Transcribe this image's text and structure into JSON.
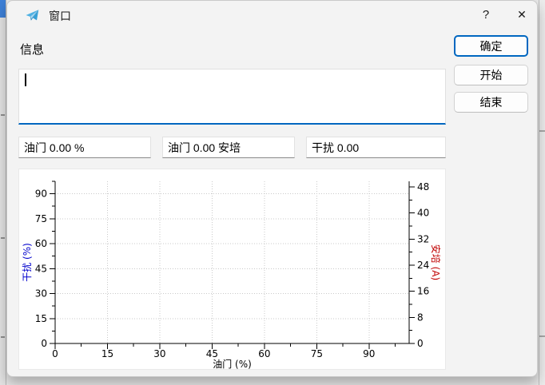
{
  "titlebar": {
    "title": "窗口",
    "help_label": "?",
    "close_label": "✕"
  },
  "panel": {
    "info_label": "信息",
    "info_value": ""
  },
  "buttons": {
    "ok": "确定",
    "start": "开始",
    "end": "结束"
  },
  "fields": {
    "throttle_percent": "油门 0.00 %",
    "throttle_amp": "油门 0.00 安培",
    "interference": "干扰 0.00"
  },
  "colors": {
    "accent": "#0067c0",
    "left_axis": "#0000cc",
    "right_axis": "#c00000",
    "grid": "#c9c9c9"
  },
  "chart_data": {
    "type": "line",
    "title": "",
    "xlabel": "油门 (%)",
    "ylabel_left": "干扰 (%)",
    "ylabel_right": "安培 (A)",
    "xticks": [
      0,
      15,
      30,
      45,
      60,
      75,
      90
    ],
    "yticks_left": [
      0,
      15,
      30,
      45,
      60,
      75,
      90
    ],
    "yticks_right": [
      0,
      8,
      16,
      24,
      32,
      40,
      48
    ],
    "xlim": [
      0,
      101.5
    ],
    "ylim_left": [
      0,
      97.5
    ],
    "ylim_right": [
      0,
      49.7
    ],
    "grid": true,
    "legend": false,
    "series": []
  }
}
